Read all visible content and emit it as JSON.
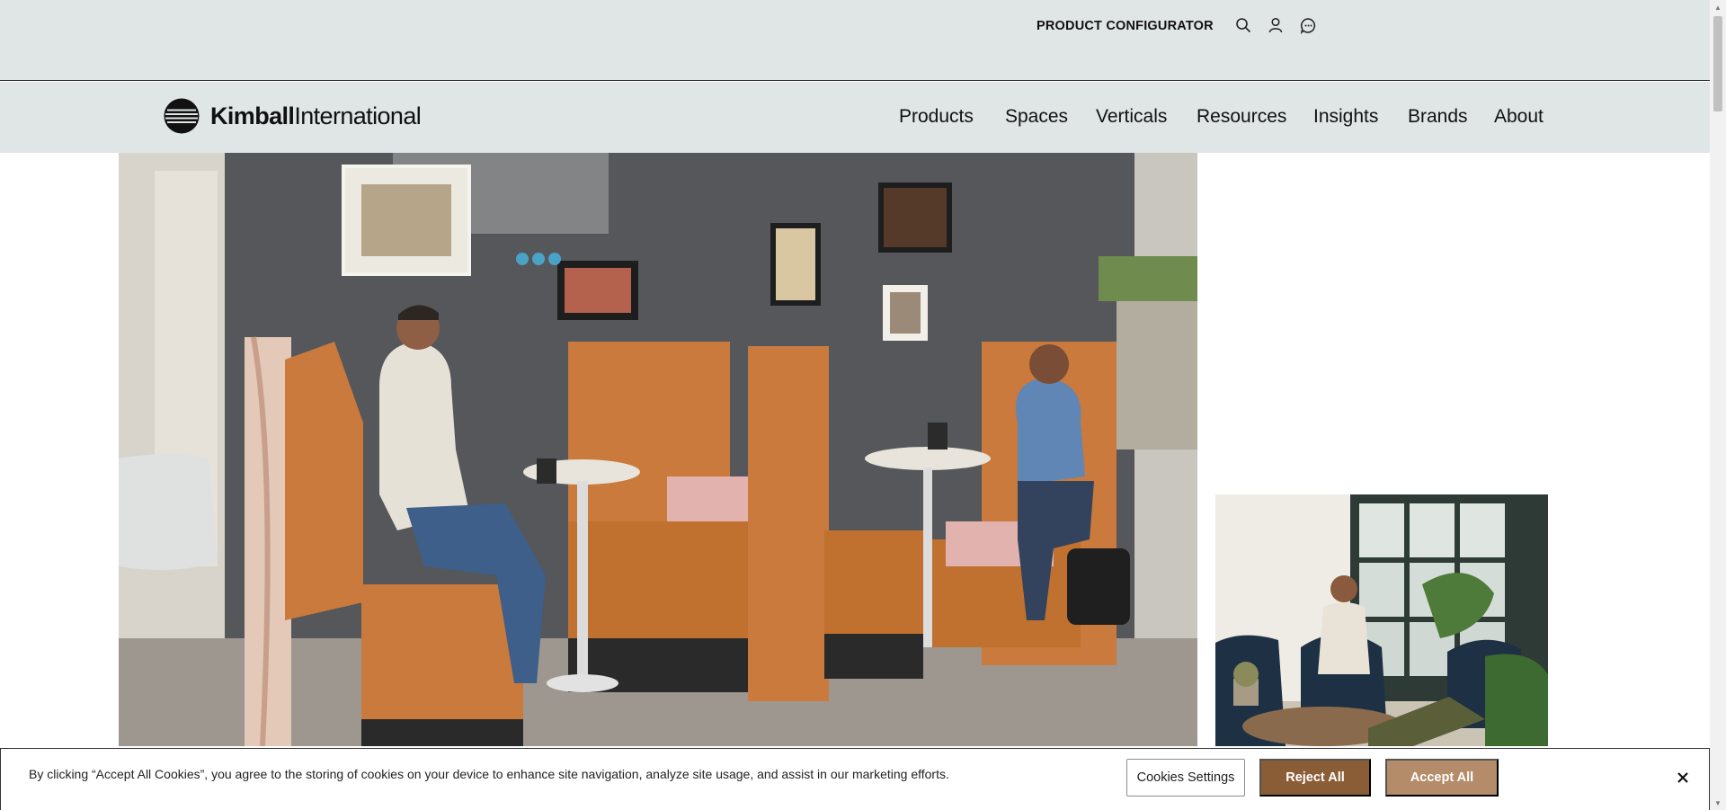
{
  "topbar": {
    "configurator_label": "PRODUCT CONFIGURATOR",
    "icons": [
      "search-icon",
      "user-icon",
      "chat-icon"
    ]
  },
  "brand": {
    "name_bold": "Kimball",
    "name_light": "International"
  },
  "nav": {
    "items": [
      "Products",
      "Spaces",
      "Verticals",
      "Resources",
      "Insights",
      "Brands",
      "About"
    ]
  },
  "cookie_banner": {
    "message": "By clicking “Accept All Cookies”, you agree to the storing of cookies on your device to enhance site navigation, analyze site usage, and assist in our marketing efforts.",
    "settings_label": "Cookies Settings",
    "reject_label": "Reject All",
    "accept_label": "Accept All",
    "close_icon": "close-icon"
  },
  "colors": {
    "header_bg": "#dfe6e5",
    "reject_bg": "#8b5d37",
    "accept_bg": "#b48c6a",
    "booth_leather": "#c97a3c",
    "wall": "#5b5d60"
  }
}
